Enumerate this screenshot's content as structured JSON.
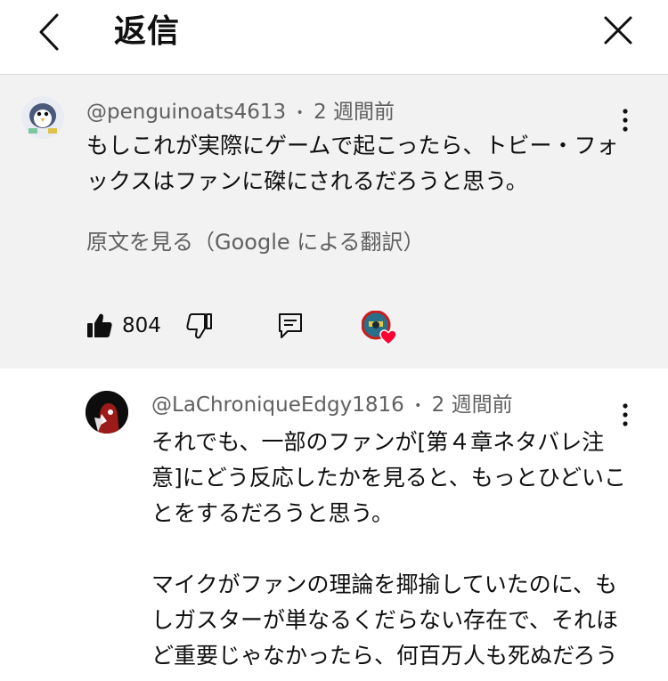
{
  "header": {
    "title": "返信"
  },
  "parent_comment": {
    "author": "@penguinoats4613",
    "separator": "•",
    "time": "2 週間前",
    "text": "もしこれが実際にゲームで起こったら、トビー・フォックスはファンに磔にされるだろうと思う。",
    "translate_link": "原文を見る（Google による翻訳）",
    "like_count": "804"
  },
  "reply_comment": {
    "author": "@LaChroniqueEdgy1816",
    "separator": "•",
    "time": "2 週間前",
    "text": "それでも、一部のファンが[第４章ネタバレ注意]にどう反応したかを見ると、もっとひどいことをするだろうと思う。\n\nマイクがファンの理論を揶揄していたのに、もしガスターが単なるくだらない存在で、それほど重要じゃなかったら、何百万人も死ぬだろう"
  },
  "icons": {
    "back": "chevron-left-icon",
    "close": "close-icon",
    "menu": "more-vert-icon",
    "like": "thumbs-up-icon",
    "dislike": "thumbs-down-icon",
    "reply": "comment-icon",
    "heart": "creator-heart-icon"
  },
  "colors": {
    "heart": "#ff0033",
    "parent_background": "#f2f2f2",
    "secondary_text": "#606060"
  }
}
